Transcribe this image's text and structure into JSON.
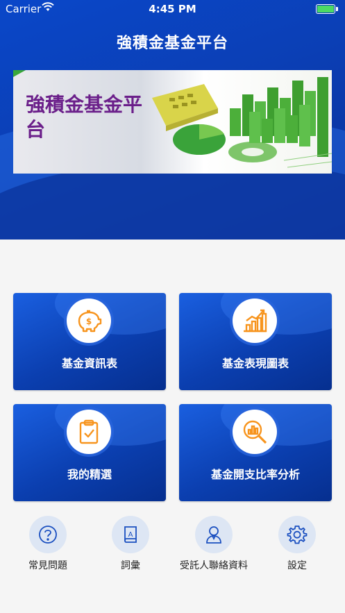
{
  "status_bar": {
    "carrier": "Carrier",
    "time": "4:45 PM"
  },
  "header": {
    "title": "強積金基金平台"
  },
  "banner": {
    "text": "強積金基金平台"
  },
  "cards": [
    {
      "label": "基金資訊表",
      "icon": "piggy-bank-icon"
    },
    {
      "label": "基金表現圖表",
      "icon": "bar-chart-icon"
    },
    {
      "label": "我的精選",
      "icon": "clipboard-check-icon"
    },
    {
      "label": "基金開支比率分析",
      "icon": "chart-magnifier-icon"
    }
  ],
  "bottom_menu": [
    {
      "label": "常見問題",
      "icon": "question-icon"
    },
    {
      "label": "詞彙",
      "icon": "glossary-book-icon"
    },
    {
      "label": "受託人聯絡資料",
      "icon": "trustee-contact-icon"
    },
    {
      "label": "設定",
      "icon": "gear-icon"
    }
  ],
  "colors": {
    "primary": "#0b3fb5",
    "accent": "#f7941d",
    "banner_text": "#6b1f8a"
  }
}
